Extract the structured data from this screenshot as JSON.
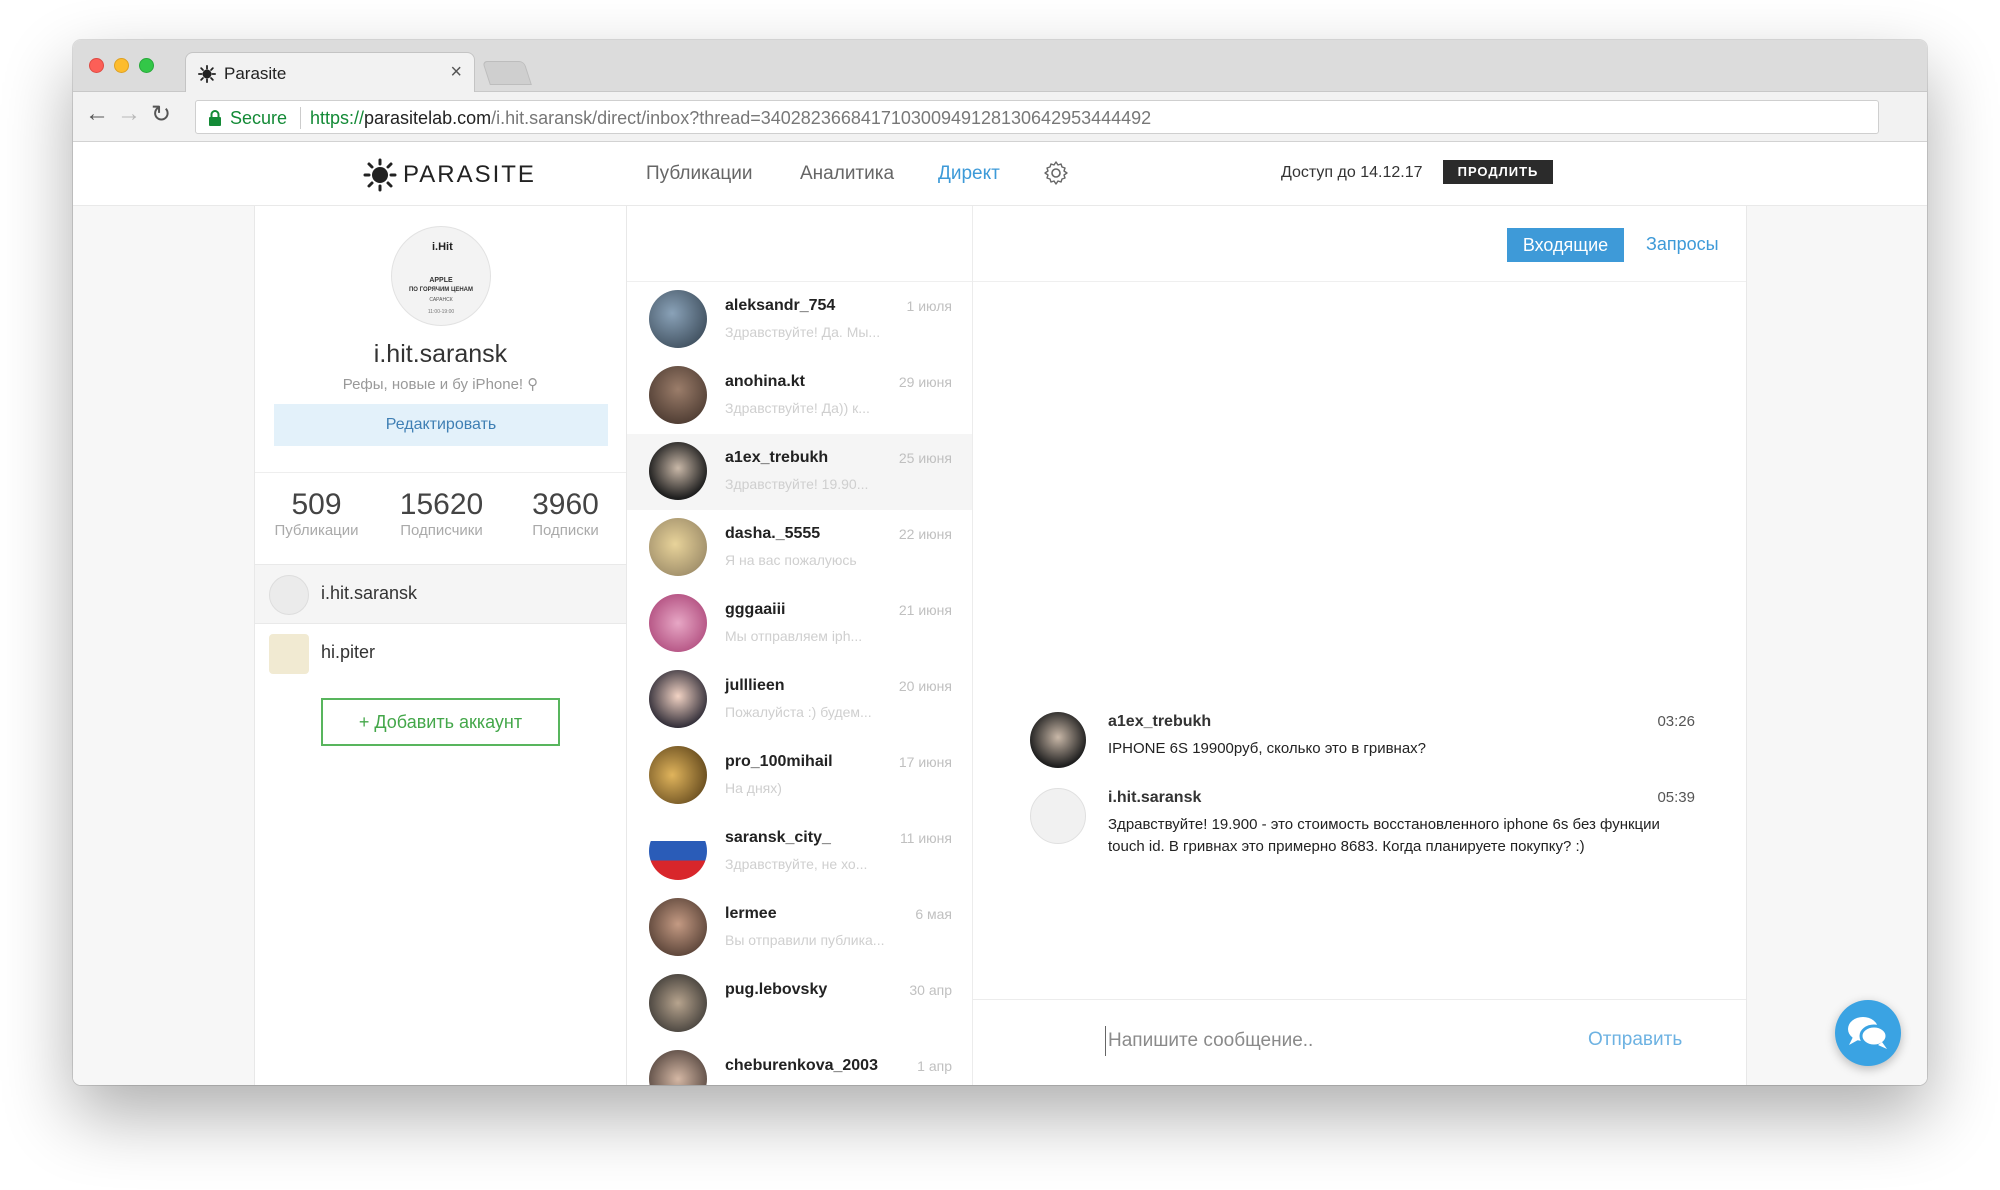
{
  "browser": {
    "tab_title": "Parasite",
    "tab_close": "×",
    "secure_label": "Secure",
    "url_scheme": "https://",
    "url_host": "parasitelab.com",
    "url_path": "/i.hit.saransk/direct/inbox?thread=340282366841710300949128130642953444492",
    "back": "←",
    "forward": "→",
    "reload": "↻"
  },
  "header": {
    "logo": "PARASITE",
    "nav": [
      "Публикации",
      "Аналитика",
      "Директ"
    ],
    "active_nav": "Директ",
    "access": "Доступ до 14.12.17",
    "renew": "ПРОДЛИТЬ"
  },
  "profile": {
    "avatar_text": {
      "brand": "i.Hit",
      "line1": "APPLE",
      "line2": "ПО ГОРЯЧИМ ЦЕНАМ",
      "line3": "САРАНСК",
      "line4": "11:00-19:00"
    },
    "username": "i.hit.saransk",
    "bio": "Рефы, новые и бу iPhone!",
    "edit": "Редактировать",
    "stats": [
      {
        "value": "509",
        "label": "Публикации"
      },
      {
        "value": "15620",
        "label": "Подписчики"
      },
      {
        "value": "3960",
        "label": "Подписки"
      }
    ],
    "accounts": [
      "i.hit.saransk",
      "hi.piter"
    ],
    "add_account": "+ Добавить аккаунт"
  },
  "threads": [
    {
      "name": "aleksandr_754",
      "date": "1 июля",
      "preview": "Здравствуйте! Да. Мы..."
    },
    {
      "name": "anohina.kt",
      "date": "29 июня",
      "preview": "Здравствуйте! Да)) к..."
    },
    {
      "name": "a1ex_trebukh",
      "date": "25 июня",
      "preview": "Здравствуйте! 19.90..."
    },
    {
      "name": "dasha._5555",
      "date": "22 июня",
      "preview": "Я на вас пожалуюсь"
    },
    {
      "name": "gggaaiii",
      "date": "21 июня",
      "preview": "Мы отправляем iph..."
    },
    {
      "name": "julllieen",
      "date": "20 июня",
      "preview": "Пожалуйста :) будем..."
    },
    {
      "name": "pro_100mihail",
      "date": "17 июня",
      "preview": "На днях)"
    },
    {
      "name": "saransk_city_",
      "date": "11 июня",
      "preview": "Здравствуйте, не хо..."
    },
    {
      "name": "lermee",
      "date": "6 мая",
      "preview": "Вы отправили публика..."
    },
    {
      "name": "pug.lebovsky",
      "date": "30 апр",
      "preview": ""
    },
    {
      "name": "cheburenkova_2003",
      "date": "1 апр",
      "preview": ""
    }
  ],
  "conversation": {
    "tab_inbox": "Входящие",
    "tab_requests": "Запросы",
    "messages": [
      {
        "name": "a1ex_trebukh",
        "time": "03:26",
        "text": "IPHONE 6S 19900руб, сколько это в гривнах?"
      },
      {
        "name": "i.hit.saransk",
        "time": "05:39",
        "text": "Здравствуйте! 19.900 - это стоимость восстановленного iphone 6s без функции touch id. В гривнах это примерно 8683. Когда планируете покупку? :)"
      }
    ],
    "placeholder": "Напишите сообщение..",
    "send": "Отправить"
  },
  "colors": {
    "accent": "#3e9ad8",
    "green": "#44a74a",
    "dark": "#2b2b2b"
  }
}
